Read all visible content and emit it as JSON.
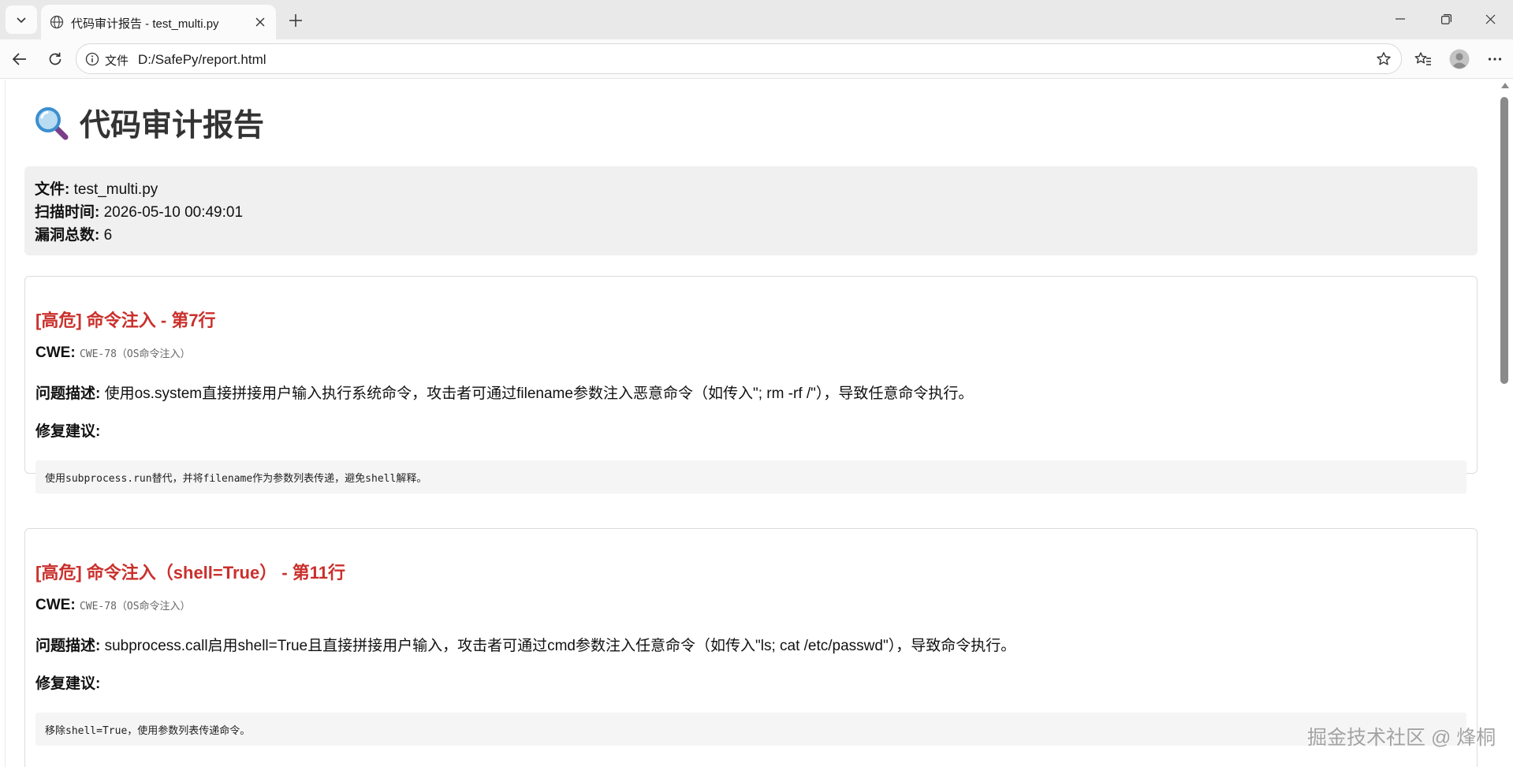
{
  "browser": {
    "tab_title": "代码审计报告 - test_multi.py",
    "address_scheme_label": "文件",
    "address_url": "D:/SafePy/report.html"
  },
  "report": {
    "title": "代码审计报告",
    "summary": {
      "file_label": "文件:",
      "file_value": "test_multi.py",
      "time_label": "扫描时间:",
      "time_value": "2026-05-10 00:49:01",
      "count_label": "漏洞总数:",
      "count_value": "6"
    },
    "vulns": [
      {
        "title": "[高危] 命令注入 - 第7行",
        "cwe_label": "CWE:",
        "cwe_value": "CWE-78（OS命令注入）",
        "desc_label": "问题描述:",
        "desc_value": "使用os.system直接拼接用户输入执行系统命令，攻击者可通过filename参数注入恶意命令（如传入\"; rm -rf /\"），导致任意命令执行。",
        "fix_label": "修复建议:",
        "fix_value": "使用subprocess.run替代，并将filename作为参数列表传递，避免shell解释。"
      },
      {
        "title": "[高危] 命令注入（shell=True） - 第11行",
        "cwe_label": "CWE:",
        "cwe_value": "CWE-78（OS命令注入）",
        "desc_label": "问题描述:",
        "desc_value": "subprocess.call启用shell=True且直接拼接用户输入，攻击者可通过cmd参数注入任意命令（如传入\"ls; cat /etc/passwd\"），导致命令执行。",
        "fix_label": "修复建议:",
        "fix_value": "移除shell=True，使用参数列表传递命令。"
      }
    ]
  },
  "watermark": "掘金技术社区 @ 烽桐",
  "colors": {
    "severity_high": "#c9302c",
    "summary_bg": "#f0f0f0",
    "code_bg": "#f5f5f5"
  }
}
